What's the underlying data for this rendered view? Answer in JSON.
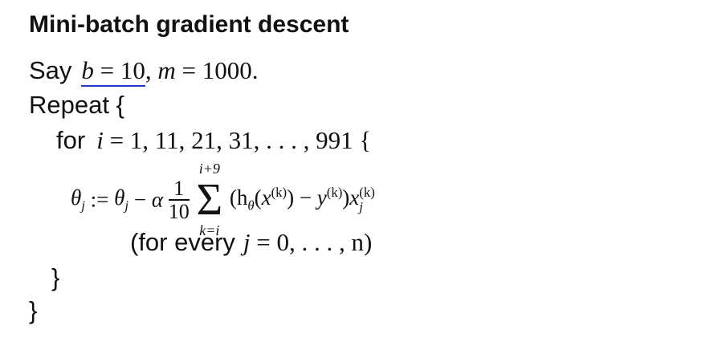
{
  "slide": {
    "title": "Mini-batch gradient descent",
    "say_text": "Say",
    "say_b": "b",
    "say_b_value": "10",
    "say_m": "m",
    "say_m_value": "1000",
    "repeat_text": "Repeat {",
    "for_text": "for",
    "for_var": "i",
    "for_values": "1, 11, 21, 31, . . . , 991",
    "for_brace": "{",
    "update_theta": "θ",
    "update_j": "j",
    "update_alpha": "α",
    "frac_num": "1",
    "frac_den": "10",
    "sum_upper": "i+9",
    "sum_lower": "k=i",
    "sum_term": "(h",
    "h_sub": "θ",
    "x_k": "x",
    "k_sup": "(k)",
    "y_k": "y",
    "xj": "x",
    "every_text": "(for every",
    "every_var": "j",
    "every_range": "0, . . . , n)",
    "inner_close": "}",
    "outer_close": "}"
  },
  "colors": {
    "underline": "#2236c9"
  }
}
